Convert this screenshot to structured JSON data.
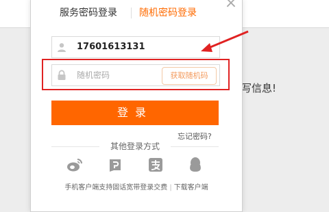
{
  "background": {
    "info_text": "写信息!"
  },
  "modal": {
    "close_symbol": "×",
    "tabs": [
      {
        "label": "服务密码登录",
        "active": false
      },
      {
        "label": "随机密码登录",
        "active": true
      }
    ],
    "phone_field": {
      "value": "17601613131",
      "icon": "user-icon"
    },
    "code_field": {
      "placeholder": "随机密码",
      "icon": "lock-icon",
      "get_code_label": "获取随机码"
    },
    "login_button_label": "登录",
    "forgot_label": "忘记密码?",
    "other_login_label": "其他登录方式",
    "social_icons": [
      "weibo-icon",
      "p-icon",
      "alipay-icon",
      "qq-icon"
    ],
    "footer": {
      "text": "手机客户端支持固话宽带登录交费",
      "link": "下载客户端"
    }
  },
  "colors": {
    "accent": "#ff6600",
    "annotation": "#e02222"
  }
}
